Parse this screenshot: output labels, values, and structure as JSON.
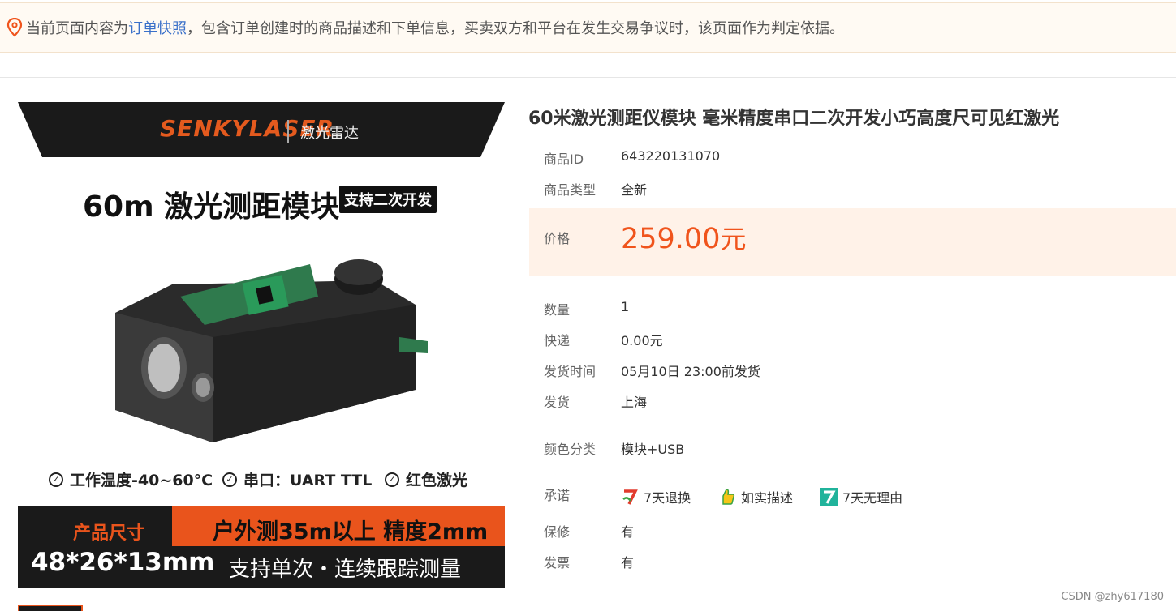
{
  "notice": {
    "prefix": "当前页面内容为",
    "link": "订单快照",
    "suffix": "，包含订单创建时的商品描述和下单信息，买卖双方和平台在发生交易争议时，该页面作为判定依据。"
  },
  "image": {
    "brand": "SENKYLASER",
    "brand_cn": "激光雷达",
    "headline": "60m 激光测距模块",
    "tag": "支持二次开发",
    "features": [
      "工作温度-40~60°C",
      "串口：UART TTL",
      "红色激光"
    ],
    "size_label": "产品尺寸",
    "size_value": "48*26*13mm",
    "slogan1": "户外测35m以上 精度2mm",
    "slogan2": "支持单次・连续跟踪测量"
  },
  "product": {
    "title": "60米激光测距仪模块 毫米精度串口二次开发小巧高度尺可见红激光",
    "id_label": "商品ID",
    "id_value": "643220131070",
    "type_label": "商品类型",
    "type_value": "全新",
    "price_label": "价格",
    "price_value": "259.00",
    "price_unit": "元",
    "qty_label": "数量",
    "qty_value": "1",
    "shipping_label": "快递",
    "shipping_value": "0.00元",
    "ship_time_label": "发货时间",
    "ship_time_value": "05月10日 23:00前发货",
    "origin_label": "发货",
    "origin_value": "上海",
    "color_label": "颜色分类",
    "color_value": "模块+USB",
    "promise_label": "承诺",
    "promises": [
      "7天退换",
      "如实描述",
      "7天无理由"
    ],
    "warranty_label": "保修",
    "warranty_value": "有",
    "invoice_label": "发票",
    "invoice_value": "有"
  },
  "watermark": "CSDN @zhy617180",
  "colors": {
    "price": "#f0541c",
    "link": "#3a70c9",
    "accent": "#e9541c"
  }
}
